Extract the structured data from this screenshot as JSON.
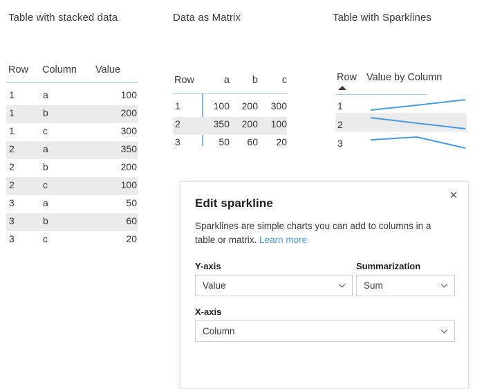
{
  "sections": {
    "stacked_title": "Table with stacked data",
    "matrix_title": "Data as Matrix",
    "sparkline_title": "Table with Sparklines"
  },
  "table_stacked": {
    "headers": {
      "row": "Row",
      "column": "Column",
      "value": "Value"
    },
    "rows": [
      {
        "row": "1",
        "column": "a",
        "value": "100"
      },
      {
        "row": "1",
        "column": "b",
        "value": "200"
      },
      {
        "row": "1",
        "column": "c",
        "value": "300"
      },
      {
        "row": "2",
        "column": "a",
        "value": "350"
      },
      {
        "row": "2",
        "column": "b",
        "value": "200"
      },
      {
        "row": "2",
        "column": "c",
        "value": "100"
      },
      {
        "row": "3",
        "column": "a",
        "value": "50"
      },
      {
        "row": "3",
        "column": "b",
        "value": "60"
      },
      {
        "row": "3",
        "column": "c",
        "value": "20"
      }
    ]
  },
  "table_matrix": {
    "headers": {
      "row": "Row",
      "a": "a",
      "b": "b",
      "c": "c"
    },
    "rows": [
      {
        "row": "1",
        "a": "100",
        "b": "200",
        "c": "300"
      },
      {
        "row": "2",
        "a": "350",
        "b": "200",
        "c": "100"
      },
      {
        "row": "3",
        "a": "50",
        "b": "60",
        "c": "20"
      }
    ]
  },
  "table_sparkline": {
    "headers": {
      "row": "Row",
      "value_by_column": "Value by Column"
    },
    "sort_indicator": "ascending",
    "rows": [
      {
        "row": "1"
      },
      {
        "row": "2"
      },
      {
        "row": "3"
      }
    ]
  },
  "dialog": {
    "title": "Edit sparkline",
    "close_label": "✕",
    "description_text": "Sparklines are simple charts you can add to columns in a table or matrix.",
    "learn_more_label": "Learn more",
    "fields": {
      "yaxis_label": "Y-axis",
      "yaxis_value": "Value",
      "summarization_label": "Summarization",
      "summarization_value": "Sum",
      "xaxis_label": "X-axis",
      "xaxis_value": "Column"
    }
  },
  "colors": {
    "accent_line": "#a6cbe8",
    "sparkline": "#4a9ae0",
    "band": "#ebebeb",
    "link": "#4a9ae0",
    "text": "#333333"
  },
  "chart_data": {
    "type": "line",
    "title": "Value by Column",
    "xlabel": "Column",
    "ylabel": "Value",
    "categories": [
      "a",
      "b",
      "c"
    ],
    "series": [
      {
        "name": "1",
        "values": [
          100,
          200,
          300
        ]
      },
      {
        "name": "2",
        "values": [
          350,
          200,
          100
        ]
      },
      {
        "name": "3",
        "values": [
          50,
          60,
          20
        ]
      }
    ],
    "ylim": [
      0,
      350
    ],
    "grid": false,
    "legend": "none"
  }
}
